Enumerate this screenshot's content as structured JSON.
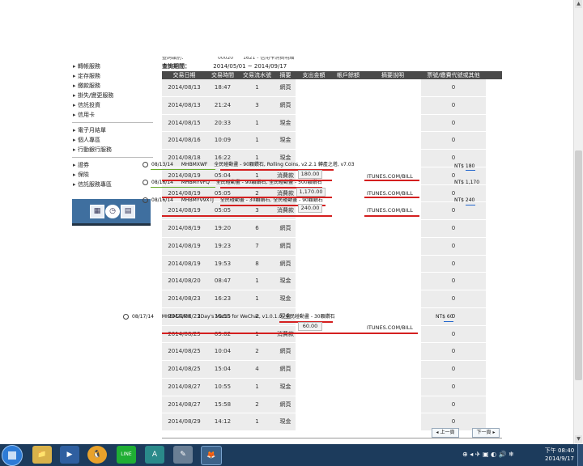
{
  "sidebar": {
    "groups": [
      [
        "轉帳服務",
        "定存服務",
        "繳款服務",
        "掛失/變更服務",
        "信託投資",
        "信用卡"
      ],
      [
        "電子月結單",
        "個人專區",
        "行動銀行服務"
      ],
      [
        "證券",
        "保險",
        "信託服務專區"
      ]
    ]
  },
  "header": {
    "cut_text": "查詢類別：　　　　　　　00020　　1621 - 信用卡消費明細",
    "period_label": "查詢期間：",
    "period_value": "2014/05/01 ~ 2014/09/17"
  },
  "table": {
    "columns": [
      "交易日期",
      "交易時間",
      "交易流水號",
      "摘要",
      "支出金額",
      "帳戶餘額",
      "摘要說明",
      "票號/繳費代號或其他"
    ],
    "rows": [
      [
        "2014/08/13",
        "18:47",
        "1",
        "網頁",
        "",
        "",
        "",
        "0"
      ],
      [
        "2014/08/13",
        "21:24",
        "3",
        "網頁",
        "",
        "",
        "",
        "0"
      ],
      [
        "2014/08/15",
        "20:33",
        "1",
        "現金",
        "",
        "",
        "",
        "0"
      ],
      [
        "2014/08/16",
        "10:09",
        "1",
        "現金",
        "",
        "",
        "",
        "0"
      ],
      [
        "2014/08/18",
        "16:22",
        "1",
        "現金",
        "",
        "",
        "",
        "0"
      ],
      [
        "2014/08/19",
        "05:04",
        "1",
        "消費款",
        "",
        "",
        "",
        "0"
      ],
      [
        "2014/08/19",
        "05:05",
        "2",
        "消費款",
        "",
        "",
        "",
        "0"
      ],
      [
        "2014/08/19",
        "05:05",
        "3",
        "消費款",
        "",
        "",
        "",
        "0"
      ],
      [
        "2014/08/19",
        "19:20",
        "6",
        "網頁",
        "",
        "",
        "",
        "0"
      ],
      [
        "2014/08/19",
        "19:23",
        "7",
        "網頁",
        "",
        "",
        "",
        "0"
      ],
      [
        "2014/08/19",
        "19:53",
        "8",
        "網頁",
        "",
        "",
        "",
        "0"
      ],
      [
        "2014/08/20",
        "08:47",
        "1",
        "現金",
        "",
        "",
        "",
        "0"
      ],
      [
        "2014/08/23",
        "16:23",
        "1",
        "現金",
        "",
        "",
        "",
        "0"
      ],
      [
        "2014/08/23",
        "16:55",
        "2",
        "現金",
        "",
        "",
        "",
        "0"
      ],
      [
        "2014/08/25",
        "05:02",
        "1",
        "消費款",
        "",
        "",
        "",
        "0"
      ],
      [
        "2014/08/25",
        "10:04",
        "2",
        "網頁",
        "",
        "",
        "",
        "0"
      ],
      [
        "2014/08/25",
        "15:04",
        "4",
        "網頁",
        "",
        "",
        "",
        "0"
      ],
      [
        "2014/08/27",
        "10:55",
        "1",
        "現金",
        "",
        "",
        "",
        "0"
      ],
      [
        "2014/08/27",
        "15:58",
        "2",
        "網頁",
        "",
        "",
        "",
        "0"
      ],
      [
        "2014/08/29",
        "14:12",
        "1",
        "現金",
        "",
        "",
        "",
        "0"
      ]
    ]
  },
  "overlays": {
    "a1": {
      "date": "08/13/14",
      "code": "MHBMXWF",
      "desc": "全民碰動畫 - 90顆鑽石, Rolling Coins, v2.2.1",
      "extra": "轉產之塔, v7.03",
      "amount": "NT$ 180"
    },
    "a2": {
      "date": "08/16/14",
      "code": "MHBMYVFQ",
      "desc": "全民碰動畫 - 90顆鑽石, 全民碰動畫 - 500顆鑽石",
      "amount": "NT$ 1,170"
    },
    "a3": {
      "date": "08/16/14",
      "code": "MHBMYV9XTJ",
      "desc": "全民碰動畫 - 30顆鑽石, 全民碰動畫 - 90顆鑽石",
      "amount": "NT$ 240"
    },
    "a4": {
      "date": "08/17/14",
      "code": "MHBMZ1MK",
      "desc": "2Day's Match for WeChat, v1.0.1.0, 全民碰動畫 - 30顆鑽石",
      "amount": "NT$ 60"
    },
    "amounts": [
      "180.00",
      "1,170.00",
      "240.00",
      "60.00"
    ],
    "itunes": "ITUNES.COM/BILL"
  },
  "pager": {
    "prev": "◂ 上一頁",
    "next": "下一頁 ▸"
  },
  "taskbar": {
    "apps": [
      "📁",
      "▶",
      "🐧",
      "LINE",
      "A",
      "✎",
      "🦊"
    ],
    "tray": "⊕ ◂ ✈ ▣ ◐ 🔊 ❄",
    "time": "下午 08:40",
    "date": "2014/9/17"
  },
  "colors": {
    "header_bg": "#4a4a4a",
    "underline": "#d41f1f",
    "accent": "#2266cc",
    "taskbar": "#1c3b5c"
  }
}
